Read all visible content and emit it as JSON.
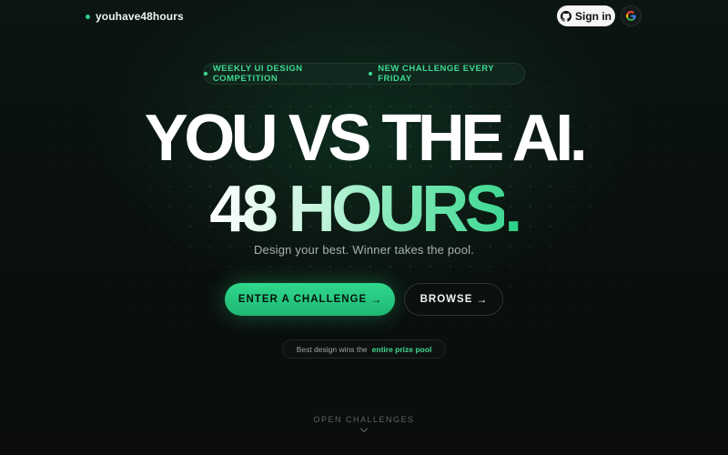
{
  "header": {
    "brand": "youhave48hours",
    "signin_label": "Sign in"
  },
  "hero": {
    "pill_left": "WEEKLY UI DESIGN COMPETITION",
    "pill_right": "NEW CHALLENGE EVERY FRIDAY",
    "headline_line1": "YOU VS THE AI.",
    "headline_line2": "48 HOURS",
    "headline_line2_period": ".",
    "subtitle": "Design your best. Winner takes the pool.",
    "primary_button": "ENTER A CHALLENGE",
    "secondary_button": "BROWSE",
    "arrow": "→",
    "note_prefix": "Best design wins the",
    "note_highlight": "entire prize pool"
  },
  "footer": {
    "open_challenges": "OPEN CHALLENGES"
  },
  "colors": {
    "accent": "#2ecf86",
    "background": "#0a0f0d",
    "text": "#ffffff"
  }
}
